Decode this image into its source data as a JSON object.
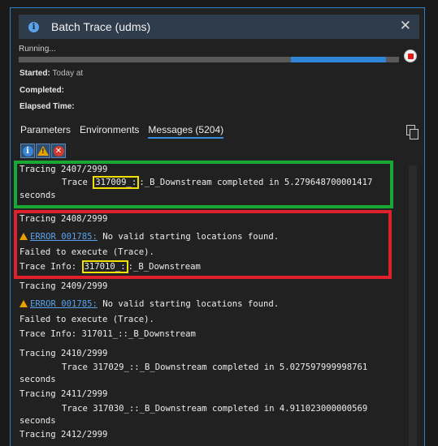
{
  "window": {
    "title": "Batch Trace (udms)",
    "close_glyph": "✕",
    "info_glyph": "i"
  },
  "status": {
    "running_label": "Running...",
    "progress_segments": [
      {
        "start_fraction": 0.0,
        "end_fraction": 0.715,
        "color": "#595959"
      },
      {
        "start_fraction": 0.715,
        "end_fraction": 0.965,
        "color": "#2f86d9"
      }
    ],
    "started_label": "Started:",
    "started_value": "Today at",
    "completed_label": "Completed:",
    "completed_value": "",
    "elapsed_label": "Elapsed Time:",
    "elapsed_value": ""
  },
  "tabs": [
    {
      "label": "Parameters",
      "active": false
    },
    {
      "label": "Environments",
      "active": false
    },
    {
      "label": "Messages (5204)",
      "active": true
    }
  ],
  "filters": [
    {
      "name": "info-filter-icon",
      "glyph": "i"
    },
    {
      "name": "warning-filter-icon",
      "glyph": "!"
    },
    {
      "name": "error-filter-icon",
      "glyph": "✕"
    }
  ],
  "messages": {
    "m1": "Tracing 2407/2999",
    "m2_prefix": "Trace ",
    "m2_id": "317009_:",
    "m2_rest": ":_B_Downstream completed in 5.279648700001417",
    "m3": "seconds",
    "m4": "Tracing 2408/2999",
    "m5_link": "ERROR 001785:",
    "m5_text": " No valid starting locations found.",
    "m6": "Failed to execute (Trace).",
    "m7_prefix": "Trace Info: ",
    "m7_id": "317010_:",
    "m7_rest": ":_B_Downstream",
    "m8": "Tracing 2409/2999",
    "m9_link": "ERROR 001785:",
    "m9_text": " No valid starting locations found.",
    "m10": "Failed to execute (Trace).",
    "m11": "Trace Info: 317011_::_B_Downstream",
    "m12": "Tracing 2410/2999",
    "m13": "Trace 317029_::_B_Downstream completed in 5.027597999998761",
    "m14": "seconds",
    "m15": "Tracing 2411/2999",
    "m16": "Trace 317030_::_B_Downstream completed in 4.911023000000569",
    "m17": "seconds",
    "m18": "Tracing 2412/2999"
  },
  "annotation_colors": {
    "success": "#19a833",
    "error": "#e0202a",
    "highlight": "#f2e100"
  }
}
